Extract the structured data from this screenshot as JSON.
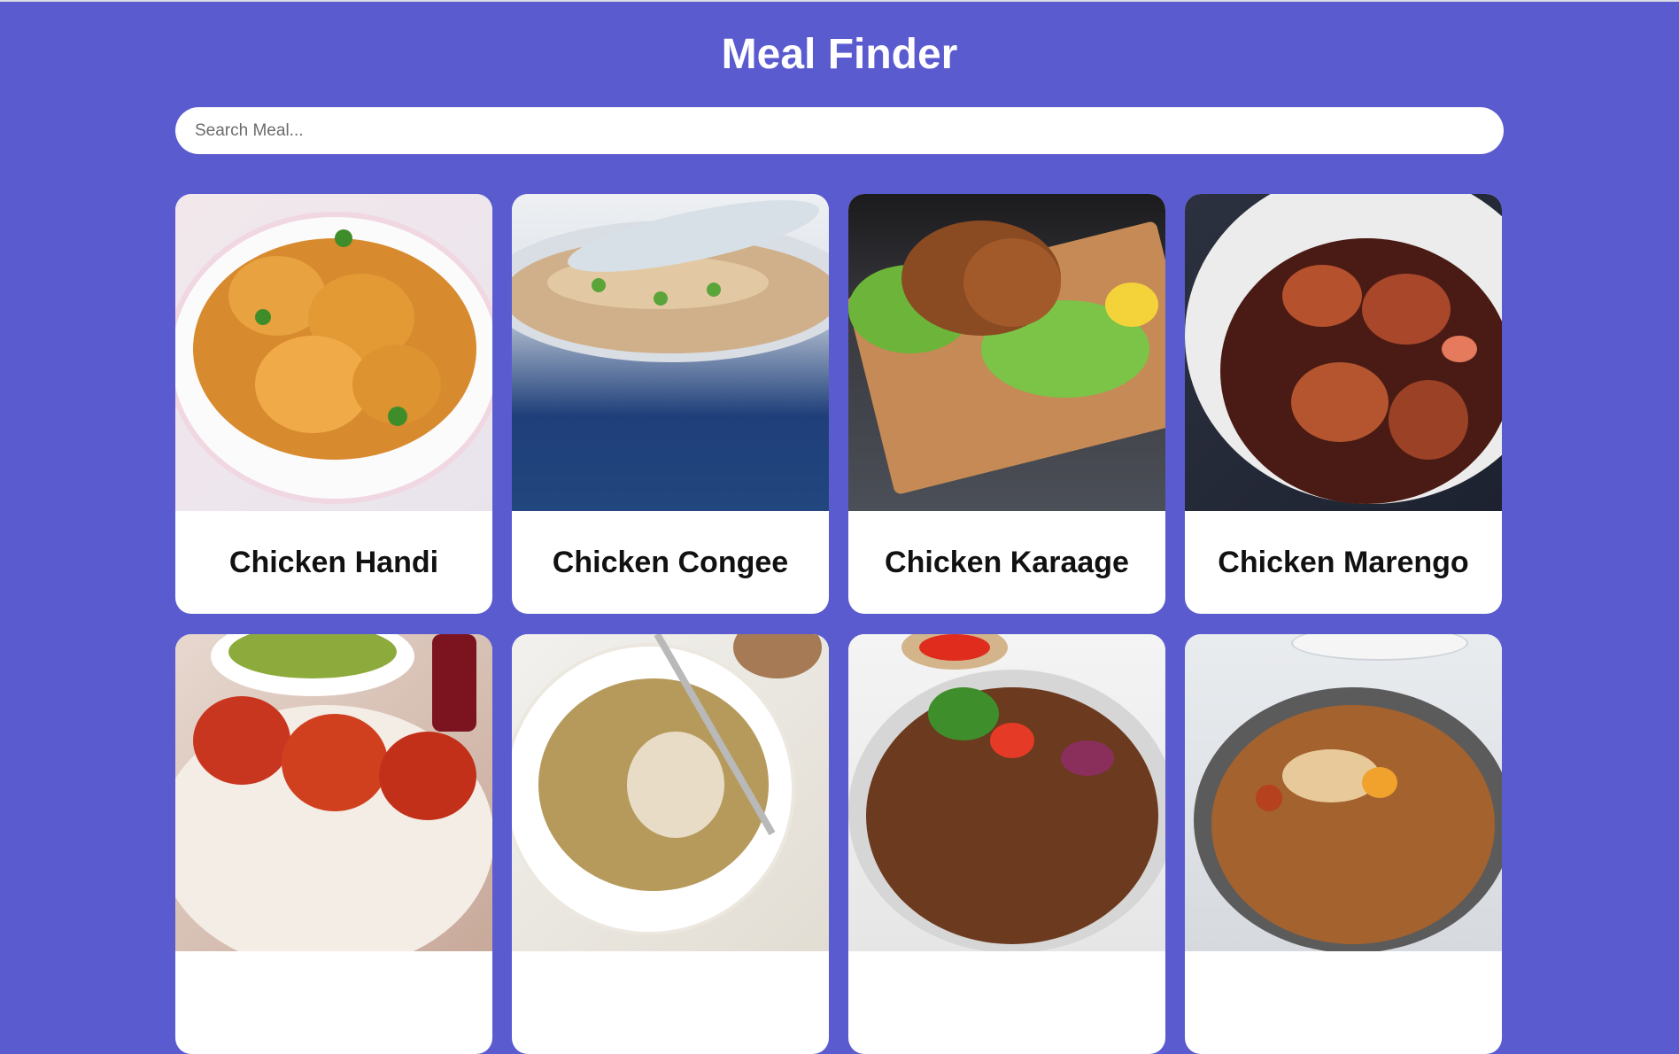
{
  "header": {
    "title": "Meal Finder"
  },
  "search": {
    "placeholder": "Search Meal...",
    "value": ""
  },
  "meals": [
    {
      "name": "Chicken Handi"
    },
    {
      "name": "Chicken Congee"
    },
    {
      "name": "Chicken Karaage"
    },
    {
      "name": "Chicken Marengo"
    },
    {
      "name": ""
    },
    {
      "name": ""
    },
    {
      "name": ""
    },
    {
      "name": ""
    }
  ],
  "colors": {
    "background": "#5b5bd0",
    "card": "#ffffff",
    "title": "#ffffff"
  }
}
